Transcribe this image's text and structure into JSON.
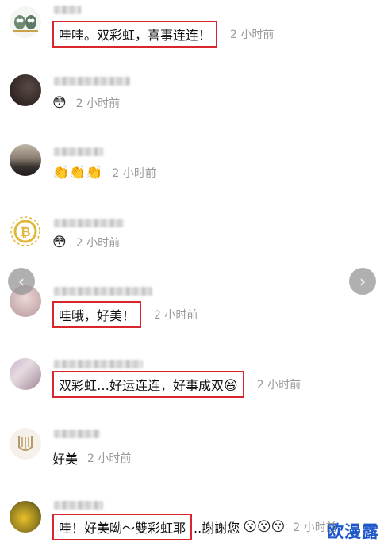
{
  "comments": [
    {
      "text": "哇哇。双彩虹，喜事连连！",
      "time": "2 小时前",
      "emoji": ""
    },
    {
      "text": "",
      "time": "2 小时前",
      "emoji": "😳"
    },
    {
      "text": "",
      "time": "2 小时前",
      "emoji": "👏👏👏"
    },
    {
      "text": "",
      "time": "2 小时前",
      "emoji": "😳"
    },
    {
      "text": "哇哦，好美！",
      "time": "2 小时前",
      "emoji": ""
    },
    {
      "text": "双彩虹…好运连连，好事成双",
      "time": "2 小时前",
      "emoji": "😆"
    },
    {
      "text": "好美",
      "time": "2 小时前",
      "emoji": ""
    },
    {
      "text": "哇！好美呦～雙彩虹耶",
      "text_after": "..謝謝您",
      "time": "2 小时前",
      "emoji": "😗😗😗"
    }
  ],
  "carousel": {
    "prev": "‹",
    "next": "›"
  },
  "watermark": "欧漫露"
}
